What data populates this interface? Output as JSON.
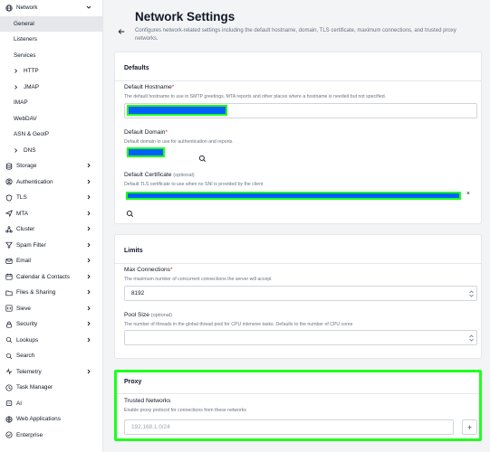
{
  "sidebar": {
    "items": [
      {
        "label": "Network",
        "icon": "globe-icon",
        "chevron": "down"
      },
      {
        "label": "General",
        "level": 1,
        "active": true
      },
      {
        "label": "Listeners",
        "level": 1
      },
      {
        "label": "Services",
        "level": 1
      },
      {
        "label": "HTTP",
        "level": 2
      },
      {
        "label": "JMAP",
        "level": 2
      },
      {
        "label": "IMAP",
        "level": 1
      },
      {
        "label": "WebDAV",
        "level": 1
      },
      {
        "label": "ASN & GeoIP",
        "level": 1
      },
      {
        "label": "DNS",
        "level": 2
      },
      {
        "label": "Storage",
        "icon": "database-icon",
        "chevron": "right"
      },
      {
        "label": "Authentication",
        "icon": "user-circle-icon",
        "chevron": "right"
      },
      {
        "label": "TLS",
        "icon": "shield-icon",
        "chevron": "right"
      },
      {
        "label": "MTA",
        "icon": "send-icon",
        "chevron": "right"
      },
      {
        "label": "Cluster",
        "icon": "cluster-icon",
        "chevron": "right"
      },
      {
        "label": "Spam Filter",
        "icon": "filter-icon",
        "chevron": "right"
      },
      {
        "label": "Email",
        "icon": "mail-icon",
        "chevron": "right"
      },
      {
        "label": "Calendar & Contacts",
        "icon": "calendar-icon",
        "chevron": "right"
      },
      {
        "label": "Files & Sharing",
        "icon": "folder-icon",
        "chevron": "right"
      },
      {
        "label": "Sieve",
        "icon": "code-icon",
        "chevron": "right"
      },
      {
        "label": "Security",
        "icon": "lock-icon",
        "chevron": "right"
      },
      {
        "label": "Lookups",
        "icon": "search-list-icon",
        "chevron": "right"
      },
      {
        "label": "Search",
        "icon": "search-icon"
      },
      {
        "label": "Telemetry",
        "icon": "activity-icon",
        "chevron": "right"
      },
      {
        "label": "Task Manager",
        "icon": "clock-icon"
      },
      {
        "label": "AI",
        "icon": "ai-icon"
      },
      {
        "label": "Web Applications",
        "icon": "browser-icon"
      },
      {
        "label": "Enterprise",
        "icon": "enterprise-icon"
      }
    ]
  },
  "header": {
    "title": "Network Settings",
    "subtitle": "Configures network-related settings including the default hostname, domain, TLS certificate, maximum connections, and trusted proxy networks."
  },
  "defaults": {
    "title": "Defaults",
    "hostname": {
      "label": "Default Hostname",
      "required": "*",
      "help": "The default hostname to use in SMTP greetings, MTA reports and other places where a hostname is needed but not specified."
    },
    "domain": {
      "label": "Default Domain",
      "required": "*",
      "help": "Default domain to use for authentication and reports."
    },
    "certificate": {
      "label": "Default Certificate",
      "optional": "(optional)",
      "help": "Default TLS certificate to use when no SNI is provided by the client",
      "clear": "×"
    }
  },
  "limits": {
    "title": "Limits",
    "max_connections": {
      "label": "Max Connections",
      "required": "*",
      "help": "The maximum number of concurrent connections the server will accept",
      "value": "8192"
    },
    "pool_size": {
      "label": "Pool Size",
      "optional": "(optional)",
      "help": "The number of threads in the global thread pool for CPU intensive tasks. Defaults to the number of CPU cores",
      "value": ""
    }
  },
  "proxy": {
    "title": "Proxy",
    "trusted": {
      "label": "Trusted Networks",
      "help": "Enable proxy protocol for connections from these networks",
      "placeholder": "192.168.1.0/24",
      "add": "+"
    }
  },
  "colors": {
    "highlight": "#1eff1e",
    "redaction": "#0060ff",
    "required": "#dc2626"
  }
}
